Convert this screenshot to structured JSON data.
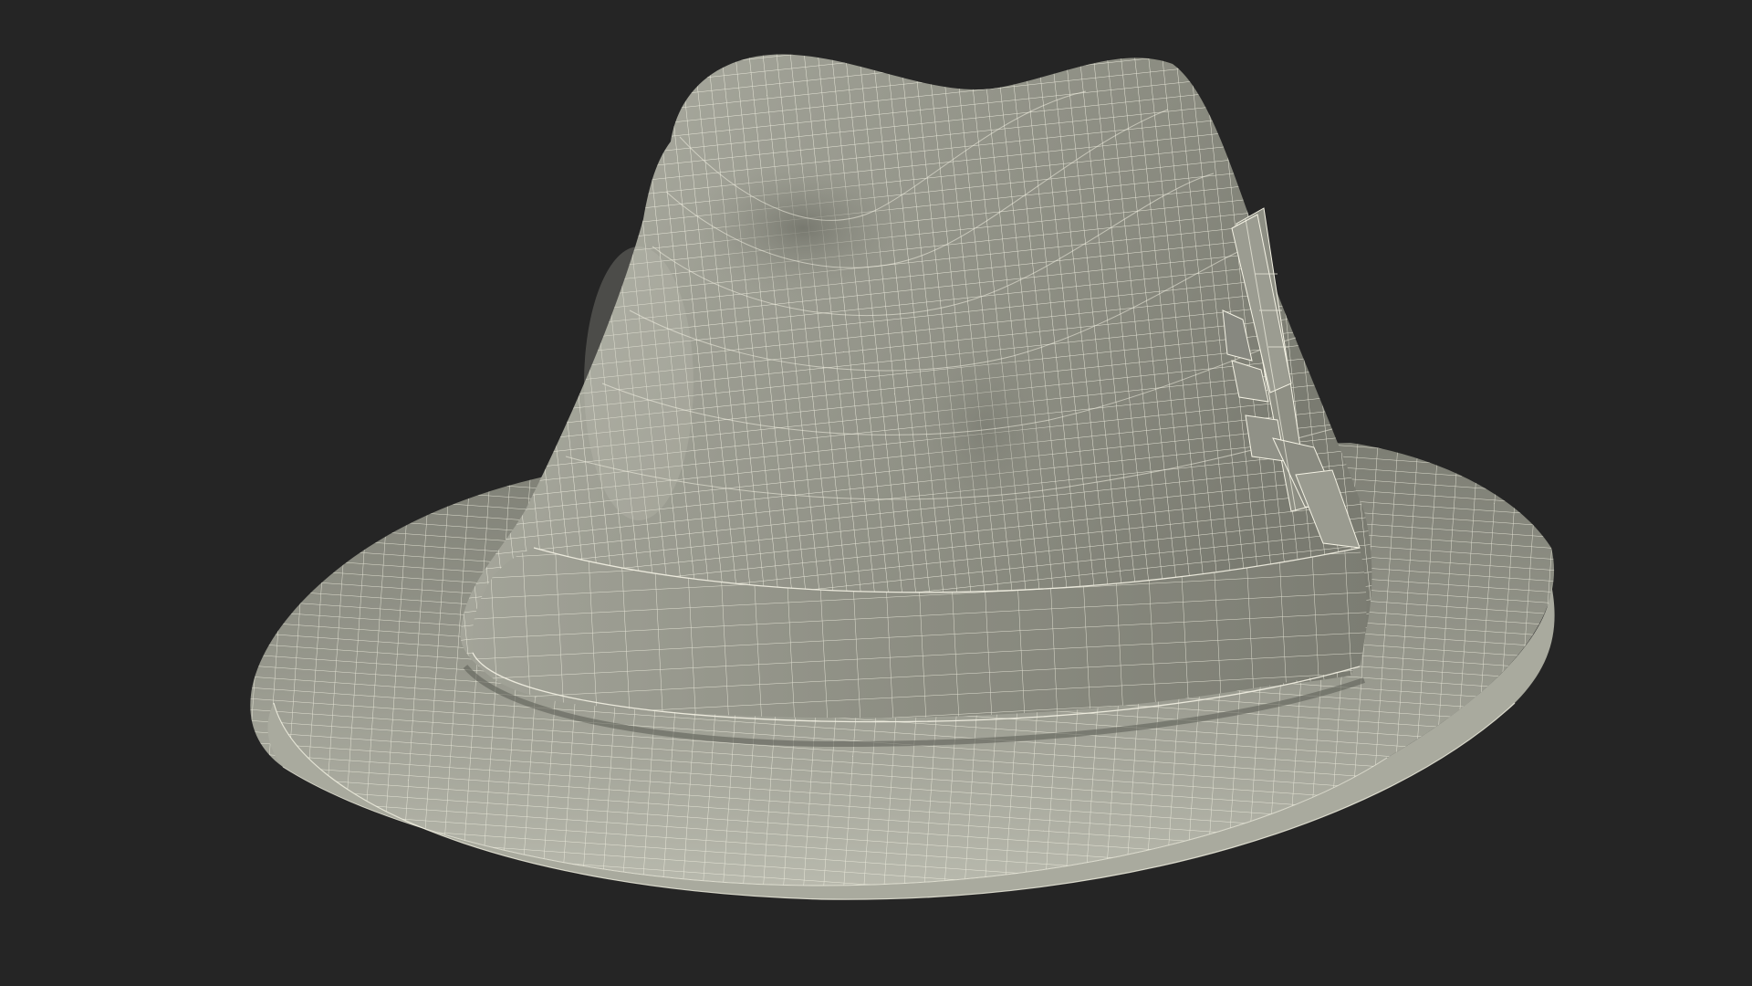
{
  "scene": {
    "subject": "fedora-hat-wireframe",
    "colors": {
      "background": "#252525",
      "surface_light": "#b2b3a7",
      "surface_mid": "#8e8f84",
      "surface_dark": "#6b6c63",
      "band": "#8a8b80",
      "feather": "#8c8d82",
      "wire": "#f4f2e4"
    },
    "parts": [
      "crown",
      "pinch",
      "band",
      "feather",
      "brim"
    ]
  }
}
